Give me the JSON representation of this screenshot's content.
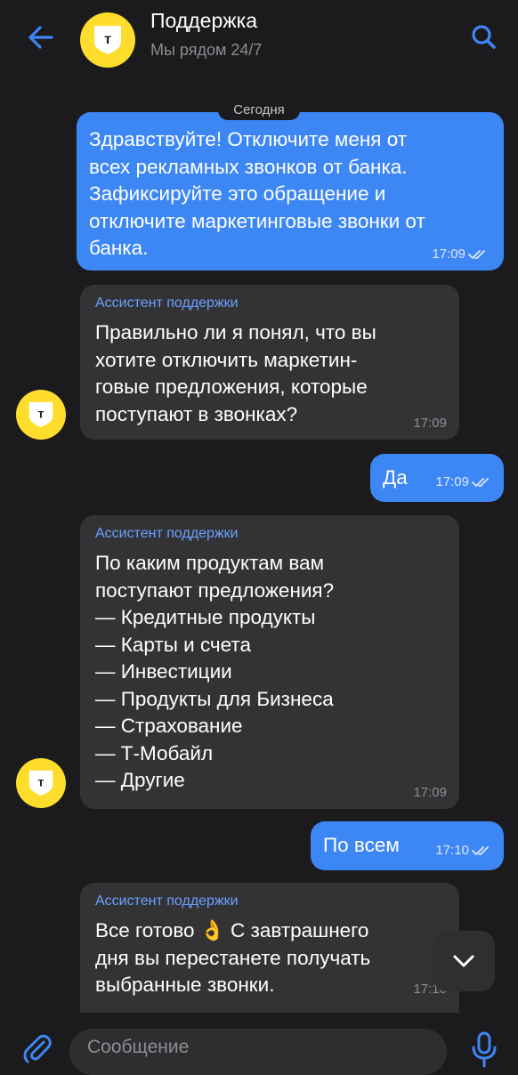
{
  "header": {
    "title": "Поддержка",
    "subtitle": "Мы рядом 24/7",
    "logo_letter": "т",
    "back_icon": "arrow-left-icon",
    "search_icon": "search-icon"
  },
  "date_separator": "Сегодня",
  "messages": [
    {
      "direction": "out",
      "text": "Здравствуйте! Отключите меня от\nвсех рекламных звонков от банка.\nЗафиксируйте это обращение и\nотключите маркетинговые звонки от\nбанка.",
      "time": "17:09",
      "status": "read"
    },
    {
      "direction": "in",
      "sender": "Ассистент поддержки",
      "text": "Правильно ли я понял, что вы\nхотите отключить маркетин-\nговые предложения, которые\nпоступают в звонках?",
      "time": "17:09"
    },
    {
      "direction": "out",
      "text": "Да",
      "time": "17:09",
      "status": "read"
    },
    {
      "direction": "in",
      "sender": "Ассистент поддержки",
      "text": "По каким продуктам вам\nпоступают предложения?\n— Кредитные продукты\n— Карты и счета\n— Инвестиции\n— Продукты для Бизнеса\n— Страхование\n— Т-Мобайл\n— Другие",
      "time": "17:09"
    },
    {
      "direction": "out",
      "text": "По всем",
      "time": "17:10",
      "status": "read"
    },
    {
      "direction": "in",
      "sender": "Ассистент поддержки",
      "text": "Все готово 👌 С завтрашнего\nдня вы перестанете получать\nвыбранные звонки.",
      "time": "17:10"
    }
  ],
  "composer": {
    "placeholder": "Сообщение",
    "attach_icon": "paperclip-icon",
    "mic_icon": "microphone-icon"
  },
  "scroll_down_icon": "chevron-down-icon",
  "colors": {
    "background": "#1b1b1d",
    "outgoing_bubble": "#3d87f5",
    "incoming_bubble": "#333336",
    "accent": "#3d87f5",
    "sender_name": "#6aa0ff",
    "brand_yellow": "#ffdd2d"
  }
}
